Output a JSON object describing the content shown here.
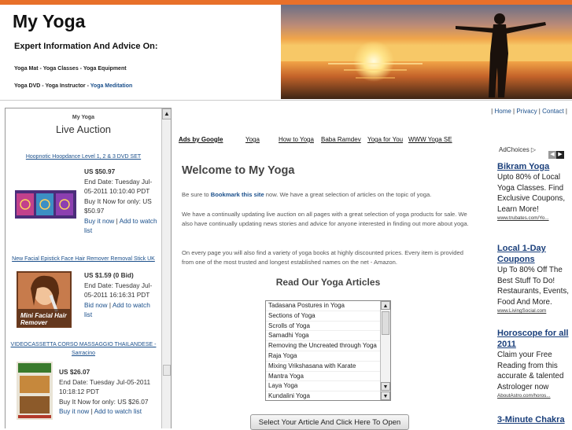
{
  "header": {
    "title": "My Yoga",
    "tagline": "Expert Information And Advice On:",
    "nav_row1": [
      {
        "label": "Yoga Mat"
      },
      {
        "label": "Yoga Classes"
      },
      {
        "label": "Yoga Equipment"
      }
    ],
    "nav_row2": [
      {
        "label": "Yoga DVD"
      },
      {
        "label": "Yoga Instructor"
      },
      {
        "label": "Yoga Meditation",
        "highlight": true
      }
    ],
    "separator": " - "
  },
  "sidebar": {
    "small_title": "My Yoga",
    "title": "Live Auction",
    "items": [
      {
        "title": "Hoopnotic Hoopdance Level 1, 2 & 3 DVD SET",
        "price": "US $50.97",
        "end_date": "End Date: Tuesday Jul-05-2011 10:10:40 PDT",
        "buy_now": "Buy It Now for only: US $50.97",
        "action1": "Buy it now",
        "action2": "Add to watch list"
      },
      {
        "title": "New Facial Epistick Face Hair Remover Removal Stick UK",
        "price": "US $1.59 (0 Bid)",
        "end_date": "End Date: Tuesday Jul-05-2011 16:16:31 PDT",
        "action1": "Bid now",
        "action2": "Add to watch list",
        "image_caption": "Mini Facial Hair Remover"
      },
      {
        "title": "VIDEOCASSETTA CORSO MASSAGGIO THAILANDESE - Sarracino",
        "price": "US $26.07",
        "end_date": "End Date: Tuesday Jul-05-2011 10:18:12 PDT",
        "buy_now": "Buy It Now for only: US $26.07",
        "action1": "Buy it now",
        "action2": "Add to watch list"
      }
    ]
  },
  "toplinks": [
    {
      "label": "Home"
    },
    {
      "label": "Privacy"
    },
    {
      "label": "Contact"
    }
  ],
  "ads_bar": {
    "label": "Ads by Google",
    "links": [
      "Yoga",
      "How to Yoga",
      "Baba Ramdev",
      "Yoga for You",
      "WWW Yoga SE"
    ]
  },
  "main": {
    "welcome": "Welcome to My Yoga",
    "p1_before": "Be sure to ",
    "p1_link": "Bookmark this site",
    "p1_after": " now. We have a great selection of articles on the topic of yoga.",
    "p2": "We have a continually updating live auction on all pages with a great selection of yoga products for sale. We also have continually updating news stories and advice for anyone interested in finding out more about yoga.",
    "p3": "On every page you will also find a variety of yoga books at highly discounted prices. Every item is provided from one of the most trusted and longest established names on the net - Amazon.",
    "articles_heading": "Read Our Yoga Articles",
    "articles": [
      "Tadasana Postures in Yoga",
      "Sections of Yoga",
      "Scrolls of Yoga",
      "Samadhi Yoga",
      "Removing the Uncreated through Yoga",
      "Raja Yoga",
      "Mixing Vrikshasana with Karate",
      "Mantra Yoga",
      "Laya Yoga",
      "Kundalini Yoga"
    ],
    "open_button": "Select Your Article And Click Here To Open"
  },
  "right_ads": {
    "adchoices": "AdChoices",
    "ads": [
      {
        "title": "Bikram Yoga",
        "body": "Upto 80% of Local Yoga Classes. Find Exclusive Coupons, Learn More!",
        "url": "www.trubates.com/Yo..."
      },
      {
        "title": "Local 1-Day Coupons",
        "body": "Up To 80% Off The Best Stuff To Do! Restaurants, Events, Food And More.",
        "url": "www.LivingSocial.com"
      },
      {
        "title": "Horoscope for all 2011",
        "body": "Claim your Free Reading from this accurate & talented Astrologer now",
        "url": "AboutAstro.com/horos..."
      },
      {
        "title": "3-Minute Chakra",
        "body": "",
        "url": ""
      }
    ]
  },
  "colors": {
    "accent_orange": "#e8702a",
    "link_blue": "#1a4f8b",
    "ad_title_blue": "#1a3f7b"
  }
}
